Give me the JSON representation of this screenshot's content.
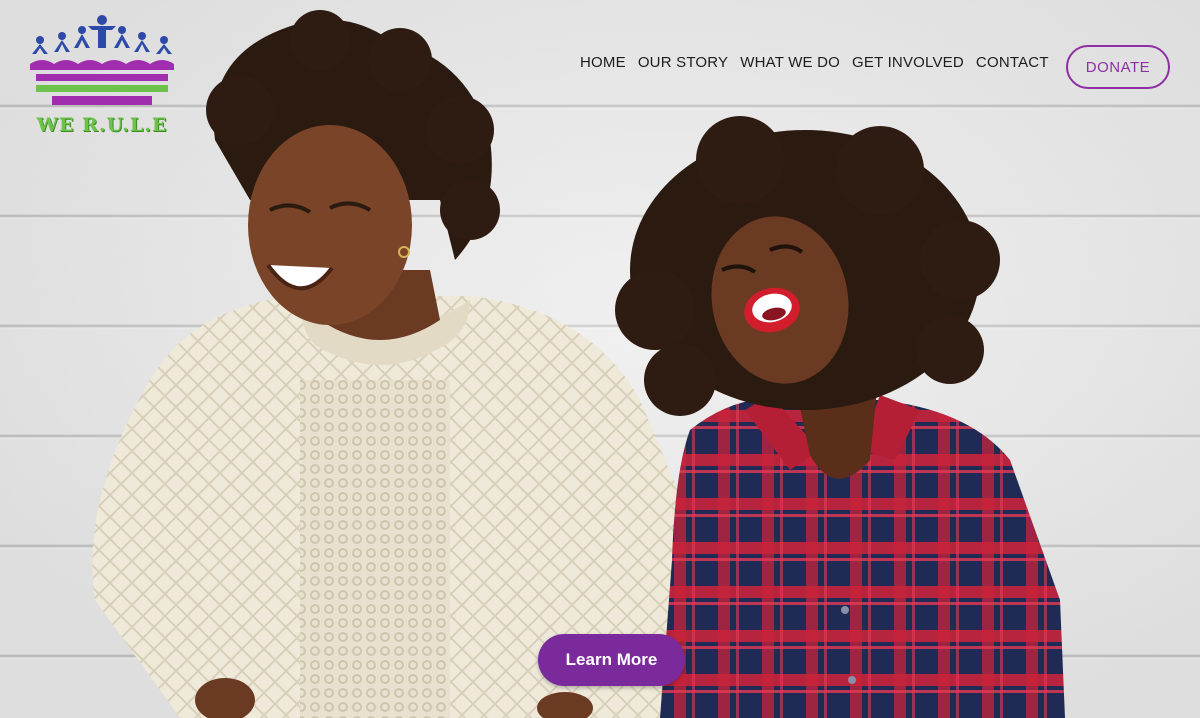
{
  "brand": {
    "logo_text": "WE R.U.L.E",
    "colors": {
      "purple": "#8e2fa3",
      "crown_blue": "#2e4aa8",
      "stripe_green": "#6cc24a",
      "stripe_magenta": "#a02dae"
    }
  },
  "nav": {
    "items": [
      {
        "label": "HOME"
      },
      {
        "label": "OUR STORY"
      },
      {
        "label": "WHAT WE DO"
      },
      {
        "label": "GET INVOLVED"
      },
      {
        "label": "CONTACT"
      }
    ],
    "donate_label": "DONATE"
  },
  "hero": {
    "cta_label": "Learn More",
    "cta_color": "#7b2a9b",
    "image": "two-women-laughing-photo"
  }
}
